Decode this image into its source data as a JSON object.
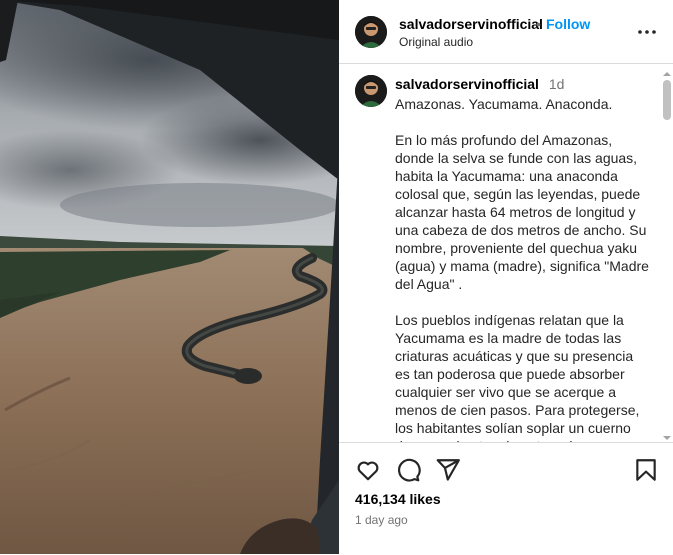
{
  "post": {
    "author": "salvadorservinofficial",
    "separator": "•",
    "follow_label": "Follow",
    "audio": "Original audio",
    "caption_author": "salvadorservinofficial",
    "caption_time": "1d",
    "caption": "Amazonas. Yacumama. Anaconda.\n\nEn lo más profundo del Amazonas, donde la selva se funde con las aguas, habita la Yacumama: una anaconda colosal que, según las leyendas, puede alcanzar hasta 64 metros de longitud y una cabeza de dos metros de ancho. Su nombre, proveniente del quechua yaku (agua) y mama (madre), significa \"Madre del Agua\" .\n\nLos pueblos indígenas relatan que la Yacumama es la madre de todas las criaturas acuáticas y que su presencia es tan poderosa que puede absorber cualquier ser vivo que se acerque a menos de cien pasos. Para protegerse, los habitantes solían soplar un cuerno de caracol antes de entrar al agua",
    "likes": "416,134 likes",
    "date": "1 day ago"
  },
  "icons": {
    "more": "more-options-icon",
    "like": "heart-icon",
    "comment": "comment-icon",
    "share": "share-icon",
    "save": "bookmark-icon"
  },
  "colors": {
    "accent": "#0095f6",
    "muted": "#737373",
    "divider": "#dbdbdb"
  }
}
